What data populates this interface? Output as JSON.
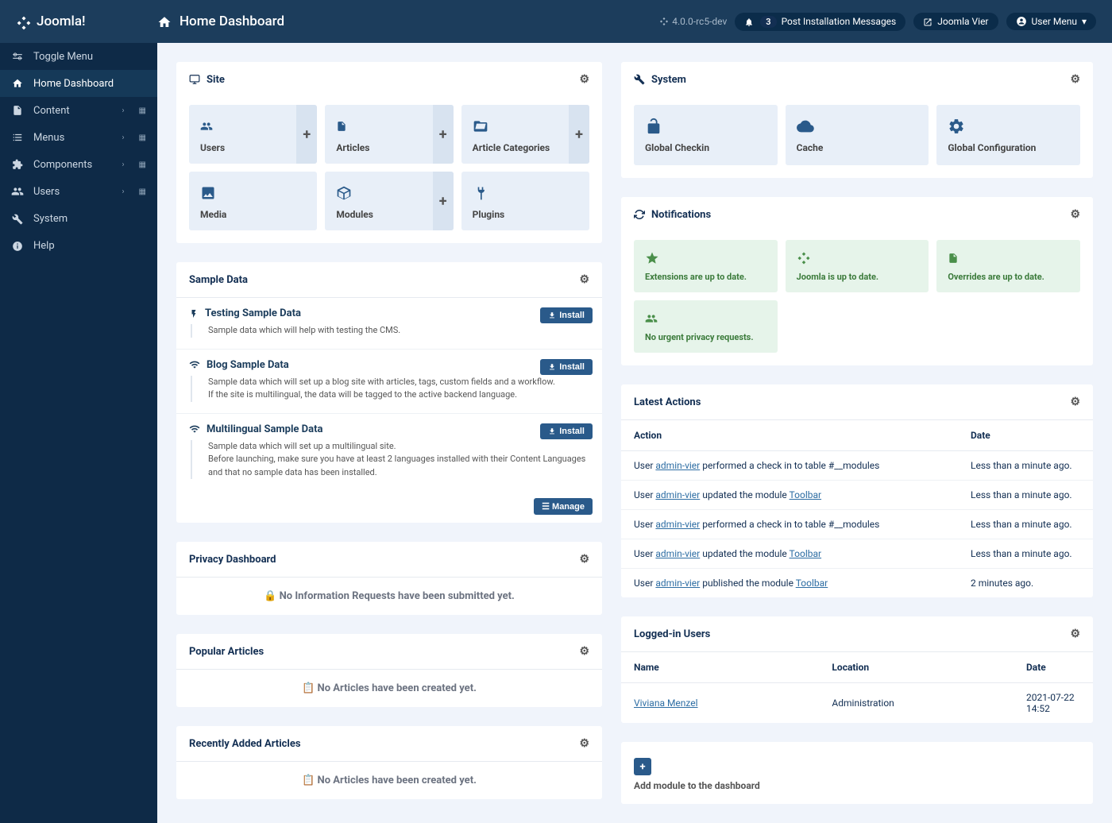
{
  "brand": "Joomla!",
  "page_title": "Home Dashboard",
  "version": "4.0.0-rc5-dev",
  "header": {
    "notifications_count": "3",
    "post_install": "Post Installation Messages",
    "site_name": "Joomla Vier",
    "user_menu": "User Menu"
  },
  "sidebar": {
    "toggle": "Toggle Menu",
    "items": [
      {
        "label": "Home Dashboard",
        "icon": "home",
        "active": true
      },
      {
        "label": "Content",
        "icon": "file",
        "expandable": true
      },
      {
        "label": "Menus",
        "icon": "list",
        "expandable": true
      },
      {
        "label": "Components",
        "icon": "puzzle",
        "expandable": true
      },
      {
        "label": "Users",
        "icon": "users",
        "expandable": true
      },
      {
        "label": "System",
        "icon": "wrench"
      },
      {
        "label": "Help",
        "icon": "info"
      }
    ]
  },
  "site_card": {
    "title": "Site",
    "items": [
      {
        "label": "Users",
        "icon": "users",
        "plus": true
      },
      {
        "label": "Articles",
        "icon": "file",
        "plus": true
      },
      {
        "label": "Article Categories",
        "icon": "folder",
        "plus": true
      },
      {
        "label": "Media",
        "icon": "image"
      },
      {
        "label": "Modules",
        "icon": "cube",
        "plus": true
      },
      {
        "label": "Plugins",
        "icon": "plug"
      }
    ]
  },
  "sample_data": {
    "title": "Sample Data",
    "install": "Install",
    "manage": "Manage",
    "items": [
      {
        "title": "Testing Sample Data",
        "desc": "Sample data which will help with testing the CMS.",
        "icon": "bolt"
      },
      {
        "title": "Blog Sample Data",
        "desc": "Sample data which will set up a blog site with articles, tags, custom fields and a workflow.\nIf the site is multilingual, the data will be tagged to the active backend language.",
        "icon": "wifi"
      },
      {
        "title": "Multilingual Sample Data",
        "desc": "Sample data which will set up a multilingual site.\nBefore launching, make sure you have at least 2 languages installed with their Content Languages and that no sample data has been installed.",
        "icon": "wifi"
      }
    ]
  },
  "privacy": {
    "title": "Privacy Dashboard",
    "empty": "No Information Requests have been submitted yet."
  },
  "popular": {
    "title": "Popular Articles",
    "empty": "No Articles have been created yet."
  },
  "recent": {
    "title": "Recently Added Articles",
    "empty": "No Articles have been created yet."
  },
  "system_card": {
    "title": "System",
    "items": [
      {
        "label": "Global Checkin",
        "icon": "unlock"
      },
      {
        "label": "Cache",
        "icon": "cloud"
      },
      {
        "label": "Global Configuration",
        "icon": "cog"
      }
    ]
  },
  "notifications": {
    "title": "Notifications",
    "items": [
      {
        "label": "Extensions are up to date.",
        "icon": "star"
      },
      {
        "label": "Joomla is up to date.",
        "icon": "joomla"
      },
      {
        "label": "Overrides are up to date.",
        "icon": "file"
      },
      {
        "label": "No urgent privacy requests.",
        "icon": "users"
      }
    ]
  },
  "latest_actions": {
    "title": "Latest Actions",
    "cols": {
      "action": "Action",
      "date": "Date"
    },
    "user_prefix": "User ",
    "rows": [
      {
        "user": "admin-vier",
        "suffix1": " performed a check in to table #__modules",
        "module": "",
        "date": "Less than a minute ago."
      },
      {
        "user": "admin-vier",
        "suffix1": " updated the module ",
        "module": "Toolbar",
        "date": "Less than a minute ago."
      },
      {
        "user": "admin-vier",
        "suffix1": " performed a check in to table #__modules",
        "module": "",
        "date": "Less than a minute ago."
      },
      {
        "user": "admin-vier",
        "suffix1": " updated the module ",
        "module": "Toolbar",
        "date": "Less than a minute ago."
      },
      {
        "user": "admin-vier",
        "suffix1": " published the module ",
        "module": "Toolbar",
        "date": "2 minutes ago."
      }
    ]
  },
  "logged_in": {
    "title": "Logged-in Users",
    "cols": {
      "name": "Name",
      "location": "Location",
      "date": "Date"
    },
    "rows": [
      {
        "name": "Viviana Menzel",
        "location": "Administration",
        "date": "2021-07-22 14:52"
      }
    ]
  },
  "add_module": "Add module to the dashboard"
}
